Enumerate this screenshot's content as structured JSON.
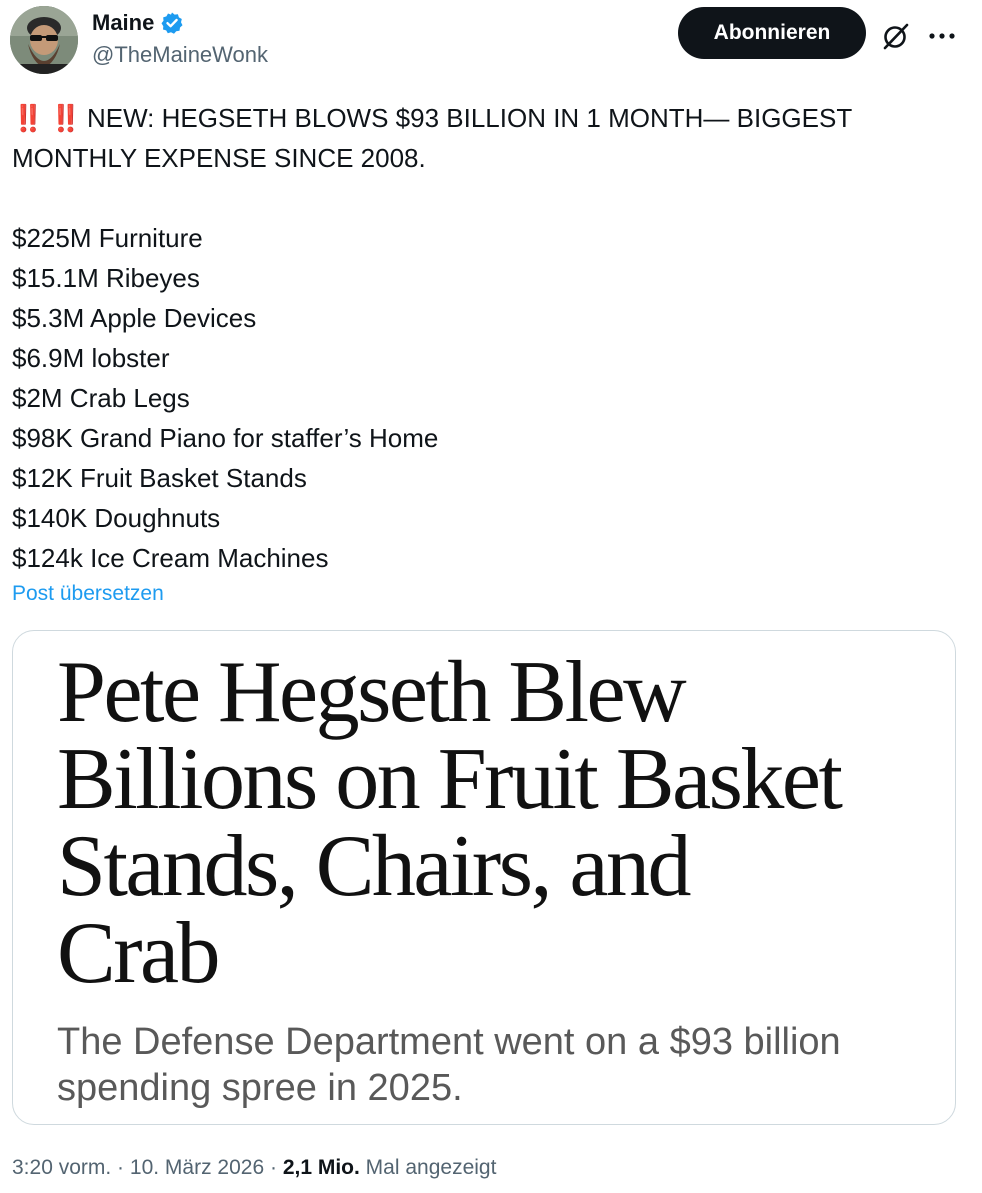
{
  "author": {
    "display_name": "Maine",
    "handle": "@TheMaineWonk",
    "verified": true
  },
  "actions": {
    "follow_label": "Abonnieren",
    "grok_icon": "grok-icon",
    "more_icon": "more-icon"
  },
  "tweet": {
    "bangs": "‼️ ‼️",
    "headline_line1": "NEW: HEGSETH BLOWS $93 BILLION IN 1 MONTH— BIGGEST",
    "headline_line2": "MONTHLY EXPENSE SINCE 2008.",
    "items": [
      "$225M Furniture",
      "$15.1M Ribeyes",
      "$5.3M Apple Devices",
      "$6.9M lobster",
      "$2M Crab Legs",
      "$98K Grand Piano for staffer’s Home",
      "$12K Fruit Basket Stands",
      "$140K Doughnuts",
      "$124k Ice Cream Machines"
    ],
    "translate_label": "Post übersetzen"
  },
  "card": {
    "title_lines": [
      "Pete Hegseth Blew",
      "Billions on Fruit Basket",
      "Stands, Chairs, and",
      "Crab"
    ],
    "subtitle_lines": [
      "The Defense Department went on a $93 billion",
      "spending spree in 2025."
    ]
  },
  "meta": {
    "time": "3:20 vorm.",
    "sep1": " · ",
    "date": "10. März 2026",
    "sep2": " · ",
    "views_count": "2,1 Mio.",
    "views_label": " Mal angezeigt"
  },
  "colors": {
    "accent": "#1d9bf0",
    "text": "#0f1419",
    "secondary": "#536471",
    "border": "#cfd9de",
    "bangs": "#e0245e"
  }
}
